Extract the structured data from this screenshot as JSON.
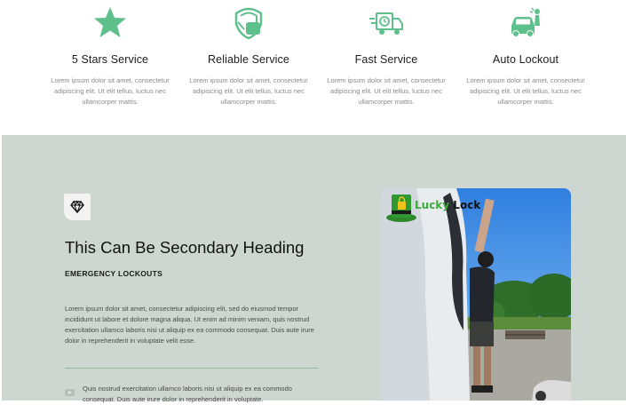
{
  "services": [
    {
      "icon": "star-icon",
      "title": "5 Stars Service",
      "description": "Lorem ipsum dolor sit amet, consectetur adipiscing elit. Ut elit tellus, luctus nec ullamcorper mattis."
    },
    {
      "icon": "shield-hand-icon",
      "title": "Reliable Service",
      "description": "Lorem ipsum dolor sit amet, consectetur adipiscing elit. Ut elit tellus, luctus nec ullamcorper mattis."
    },
    {
      "icon": "delivery-truck-icon",
      "title": "Fast Service",
      "description": "Lorem ipsum dolor sit amet, consectetur adipiscing elit. Ut elit tellus, luctus nec ullamcorper mattis."
    },
    {
      "icon": "car-lockout-icon",
      "title": "Auto Lockout",
      "description": "Lorem ipsum dolor sit amet, consectetur adipiscing elit. Ut elit tellus, luctus nec ullamcorper mattis."
    }
  ],
  "feature": {
    "badge_icon": "diamond-icon",
    "heading": "This Can Be Secondary Heading",
    "subheading": "EMERGENCY LOCKOUTS",
    "paragraph": "Lorem ipsum dolor sit amet, consectetur adipiscing elit, sed do eiusmod tempor incididunt ut labore et dolore magna aliqua. Ut enim ad minim veniam, quis nostrud exercitation ullamco laboris nisi ut aliquip ex ea commodo consequat. Duis aute irure dolor in reprehenderit in voluptate velit esse.",
    "list": [
      {
        "icon": "video-icon",
        "text": "Quis nostrud exercitation ullamco laboris nisi ut aliquip ex ea commodo consequat. Duis aute irure dolor in reprehenderit in voluptate."
      }
    ]
  },
  "logo": {
    "word1": "Lucky",
    "word2": "Lock"
  },
  "colors": {
    "accent_green": "#5ec08a",
    "section_bg": "#cdd6d0",
    "divider": "#8fb8a2"
  }
}
